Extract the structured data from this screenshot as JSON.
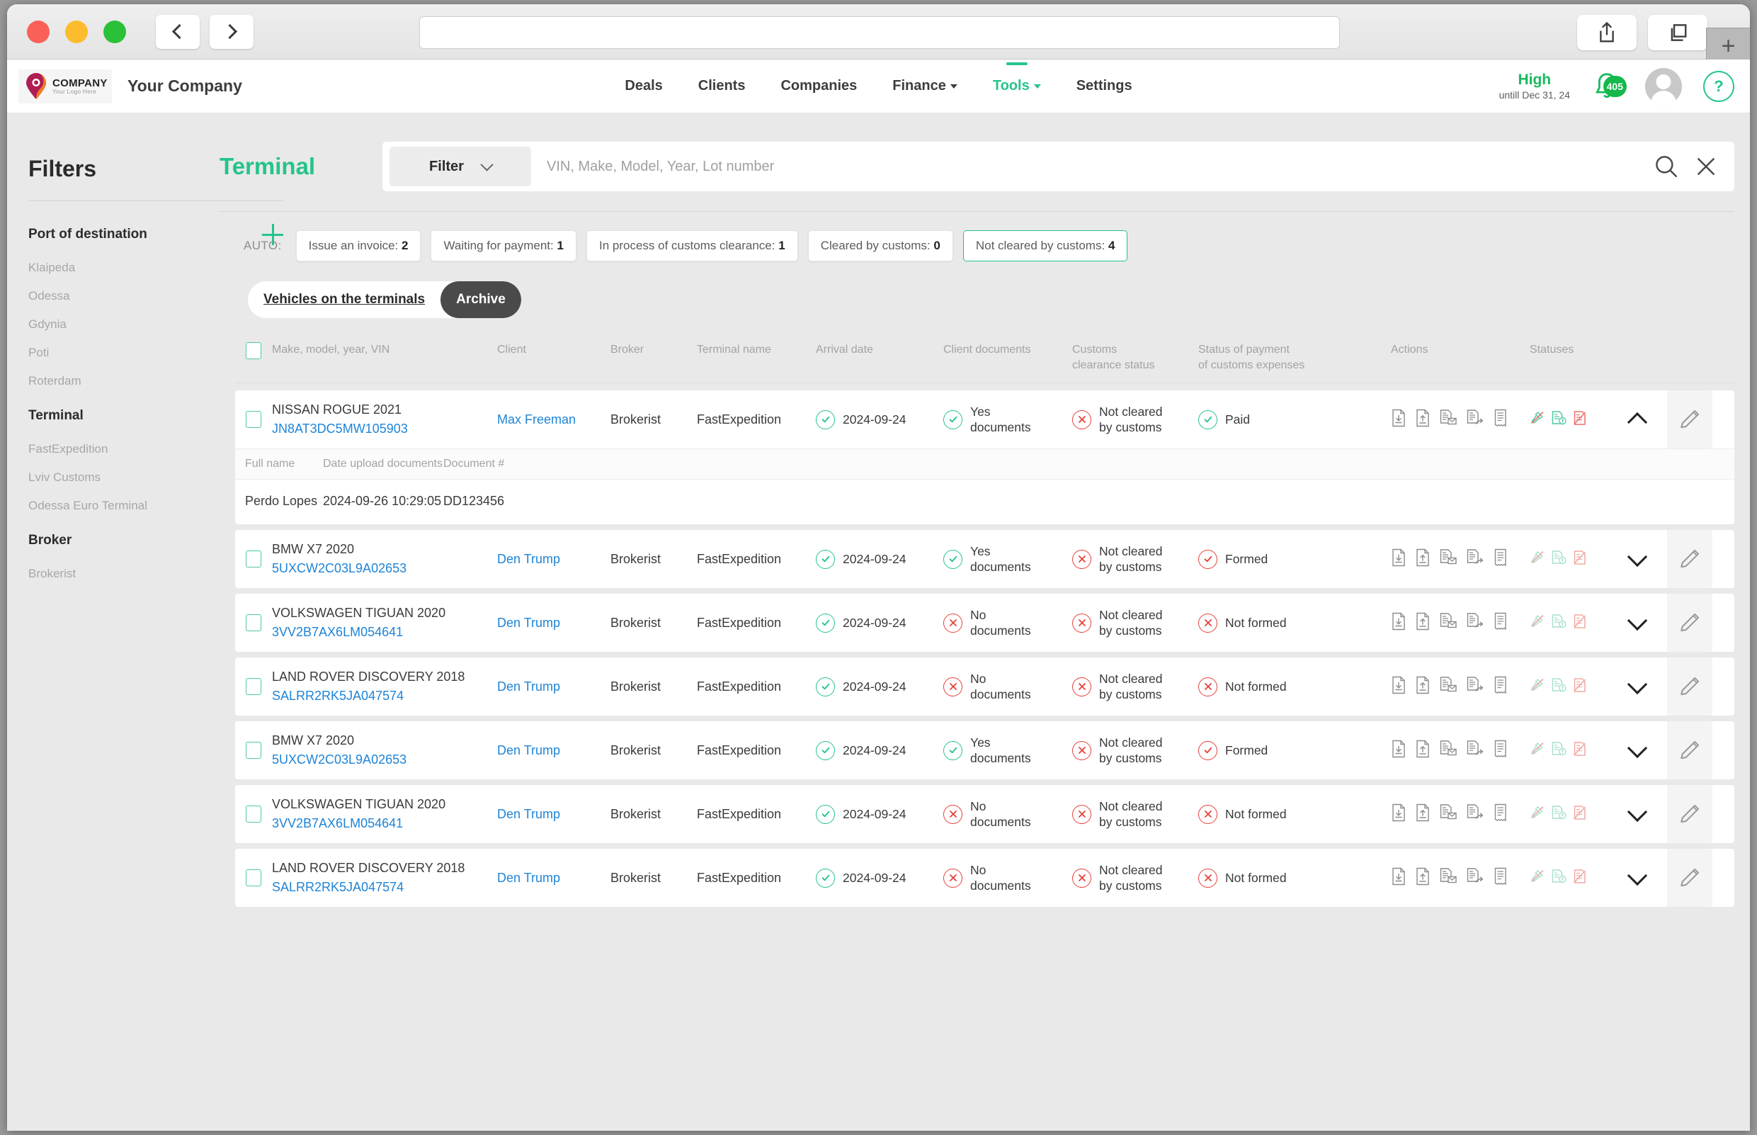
{
  "browser": {
    "back_label": "back",
    "forward_label": "forward",
    "url_value": "",
    "share_label": "share",
    "tabs_label": "tabs",
    "new_tab_label": "+"
  },
  "header": {
    "logo_line1": "COMPANY",
    "logo_line2": "Your Logo Here",
    "company_name": "Your Company",
    "nav": [
      {
        "label": "Deals",
        "active": false,
        "caret": false
      },
      {
        "label": "Clients",
        "active": false,
        "caret": false
      },
      {
        "label": "Companies",
        "active": false,
        "caret": false
      },
      {
        "label": "Finance",
        "active": false,
        "caret": true
      },
      {
        "label": "Tools",
        "active": true,
        "caret": true
      },
      {
        "label": "Settings",
        "active": false,
        "caret": false
      }
    ],
    "plan_level": "High",
    "plan_until": "untill Dec 31, 24",
    "notification_count": "405",
    "help_label": "?"
  },
  "sidebar": {
    "title": "Filters",
    "groups": [
      {
        "label": "Port of destination",
        "items": [
          "Klaipeda",
          "Odessa",
          "Gdynia",
          "Poti",
          "Roterdam"
        ]
      },
      {
        "label": "Terminal",
        "items": [
          "FastExpedition",
          "Lviv Customs",
          "Odessa Euro Terminal"
        ]
      },
      {
        "label": "Broker",
        "items": [
          "Brokerist"
        ]
      }
    ]
  },
  "main": {
    "page_title": "Terminal",
    "filter_label": "Filter",
    "search_placeholder": "VIN, Make, Model, Year, Lot number",
    "search_value": "",
    "chips_prefix": "AUTO:",
    "chips": [
      {
        "label": "Issue an invoice:",
        "count": "2",
        "active": false
      },
      {
        "label": "Waiting for payment:",
        "count": "1",
        "active": false
      },
      {
        "label": "In process of customs clearance:",
        "count": "1",
        "active": false
      },
      {
        "label": "Cleared by customs:",
        "count": "0",
        "active": false
      },
      {
        "label": "Not cleared by customs:",
        "count": "4",
        "active": true
      }
    ],
    "tabs": [
      {
        "label": "Vehicles on the terminals",
        "style": "plain"
      },
      {
        "label": "Archive",
        "style": "dark"
      }
    ],
    "columns": {
      "make": "Make, model, year, VIN",
      "client": "Client",
      "broker": "Broker",
      "terminal": "Terminal name",
      "arrival": "Arrival date",
      "client_docs": "Client documents",
      "customs_l1": "Customs",
      "customs_l2": "clearance status",
      "payment_l1": "Status of payment",
      "payment_l2": "of customs expenses",
      "actions": "Actions",
      "statuses": "Statuses"
    },
    "sub_columns": {
      "full_name": "Full name",
      "date_upload": "Date upload documents",
      "document_no": "Document #"
    },
    "rows": [
      {
        "vehicle": "NISSAN ROGUE 2021",
        "vin": "JN8AT3DC5MW105903",
        "client": "Max Freeman",
        "broker": "Brokerist",
        "terminal": "FastExpedition",
        "arrival": "2024-09-24",
        "arrival_state": "ok",
        "client_docs_l1": "Yes",
        "client_docs_l2": "documents",
        "client_docs_state": "ok",
        "customs_l1": "Not cleared",
        "customs_l2": "by customs",
        "customs_state": "bad",
        "payment": "Paid",
        "payment_state": "ok",
        "expanded": true,
        "sub": [
          {
            "full_name": "Perdo Lopes",
            "date_upload": "2024-09-26 10:29:05",
            "document_no": "DD123456"
          }
        ]
      },
      {
        "vehicle": "BMW X7 2020",
        "vin": "5UXCW2C03L9A02653",
        "client": "Den Trump",
        "broker": "Brokerist",
        "terminal": "FastExpedition",
        "arrival": "2024-09-24",
        "arrival_state": "ok",
        "client_docs_l1": "Yes",
        "client_docs_l2": "documents",
        "client_docs_state": "ok",
        "customs_l1": "Not cleared",
        "customs_l2": "by customs",
        "customs_state": "bad",
        "payment": "Formed",
        "payment_state": "redok",
        "expanded": false,
        "sub": []
      },
      {
        "vehicle": "VOLKSWAGEN TIGUAN 2020",
        "vin": "3VV2B7AX6LM054641",
        "client": "Den Trump",
        "broker": "Brokerist",
        "terminal": "FastExpedition",
        "arrival": "2024-09-24",
        "arrival_state": "ok",
        "client_docs_l1": "No",
        "client_docs_l2": "documents",
        "client_docs_state": "bad",
        "customs_l1": "Not cleared",
        "customs_l2": "by customs",
        "customs_state": "bad",
        "payment": "Not formed",
        "payment_state": "bad",
        "expanded": false,
        "sub": []
      },
      {
        "vehicle": "LAND ROVER DISCOVERY 2018",
        "vin": "SALRR2RK5JA047574",
        "client": "Den Trump",
        "broker": "Brokerist",
        "terminal": "FastExpedition",
        "arrival": "2024-09-24",
        "arrival_state": "ok",
        "client_docs_l1": "No",
        "client_docs_l2": "documents",
        "client_docs_state": "bad",
        "customs_l1": "Not cleared",
        "customs_l2": "by customs",
        "customs_state": "bad",
        "payment": "Not formed",
        "payment_state": "bad",
        "expanded": false,
        "sub": []
      },
      {
        "vehicle": "BMW X7 2020",
        "vin": "5UXCW2C03L9A02653",
        "client": "Den Trump",
        "broker": "Brokerist",
        "terminal": "FastExpedition",
        "arrival": "2024-09-24",
        "arrival_state": "ok",
        "client_docs_l1": "Yes",
        "client_docs_l2": "documents",
        "client_docs_state": "ok",
        "customs_l1": "Not cleared",
        "customs_l2": "by customs",
        "customs_state": "bad",
        "payment": "Formed",
        "payment_state": "redok",
        "expanded": false,
        "sub": []
      },
      {
        "vehicle": "VOLKSWAGEN TIGUAN 2020",
        "vin": "3VV2B7AX6LM054641",
        "client": "Den Trump",
        "broker": "Brokerist",
        "terminal": "FastExpedition",
        "arrival": "2024-09-24",
        "arrival_state": "ok",
        "client_docs_l1": "No",
        "client_docs_l2": "documents",
        "client_docs_state": "bad",
        "customs_l1": "Not cleared",
        "customs_l2": "by customs",
        "customs_state": "bad",
        "payment": "Not formed",
        "payment_state": "bad",
        "expanded": false,
        "sub": []
      },
      {
        "vehicle": "LAND ROVER DISCOVERY 2018",
        "vin": "SALRR2RK5JA047574",
        "client": "Den Trump",
        "broker": "Brokerist",
        "terminal": "FastExpedition",
        "arrival": "2024-09-24",
        "arrival_state": "ok",
        "client_docs_l1": "No",
        "client_docs_l2": "documents",
        "client_docs_state": "bad",
        "customs_l1": "Not cleared",
        "customs_l2": "by customs",
        "customs_state": "bad",
        "payment": "Not formed",
        "payment_state": "bad",
        "expanded": false,
        "sub": []
      }
    ],
    "action_icons": [
      "document-download-icon",
      "document-upload-icon",
      "document-email-icon",
      "document-share-icon",
      "receipt-icon"
    ],
    "status_icons": [
      "hammer-crossed-icon",
      "money-document-icon",
      "document-crossed-icon"
    ],
    "edit_icon": "edit-pencil-icon",
    "expand_icon": "chevron-icon"
  },
  "colors": {
    "accent": "#25c48a",
    "green": "#19ba5e",
    "red": "#e8403a",
    "link": "#1e84d6",
    "dark": "#4a4a4a"
  }
}
